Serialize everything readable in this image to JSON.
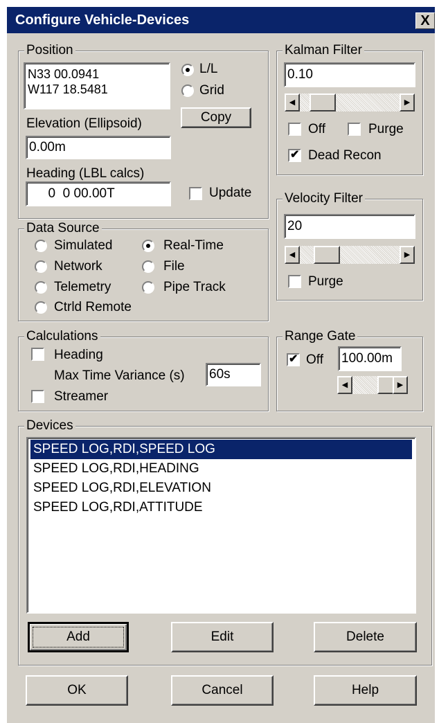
{
  "window": {
    "title": "Configure Vehicle-Devices",
    "close_label": "X"
  },
  "position": {
    "legend": "Position",
    "coord_line1": "N33 00.0941",
    "coord_line2": "W117 18.5481",
    "mode_ll": "L/L",
    "mode_grid": "Grid",
    "selected_mode": "L/L",
    "copy_label": "Copy",
    "elevation_label": "Elevation (Ellipsoid)",
    "elevation_value": "0.00m",
    "heading_label": "Heading (LBL calcs)",
    "heading_value": "  0  0 00.00T",
    "update_label": "Update",
    "update_checked": false
  },
  "kalman": {
    "legend": "Kalman Filter",
    "value": "0.10",
    "off_label": "Off",
    "off_checked": false,
    "purge_label": "Purge",
    "purge_checked": false,
    "dead_recon_label": "Dead Recon",
    "dead_recon_checked": true
  },
  "velocity": {
    "legend": "Velocity Filter",
    "value": "20",
    "purge_label": "Purge",
    "purge_checked": false
  },
  "data_source": {
    "legend": "Data Source",
    "options": [
      "Simulated",
      "Real-Time",
      "Network",
      "File",
      "Telemetry",
      "Pipe Track",
      "Ctrld Remote"
    ],
    "selected": "Real-Time"
  },
  "calculations": {
    "legend": "Calculations",
    "heading_label": "Heading",
    "heading_checked": false,
    "max_time_label": "Max Time Variance (s)",
    "max_time_value": "60s",
    "streamer_label": "Streamer",
    "streamer_checked": false
  },
  "range_gate": {
    "legend": "Range Gate",
    "off_label": "Off",
    "off_checked": true,
    "value": "100.00m"
  },
  "devices": {
    "legend": "Devices",
    "items": [
      "SPEED LOG,RDI,SPEED LOG",
      "SPEED LOG,RDI,HEADING",
      "SPEED LOG,RDI,ELEVATION",
      "SPEED LOG,RDI,ATTITUDE"
    ],
    "selected_index": 0,
    "add_label": "Add",
    "edit_label": "Edit",
    "delete_label": "Delete"
  },
  "footer": {
    "ok_label": "OK",
    "cancel_label": "Cancel",
    "help_label": "Help"
  },
  "icons": {
    "scroll_left": "left-arrow-icon",
    "scroll_right": "right-arrow-icon",
    "check": "checkmark-icon"
  }
}
